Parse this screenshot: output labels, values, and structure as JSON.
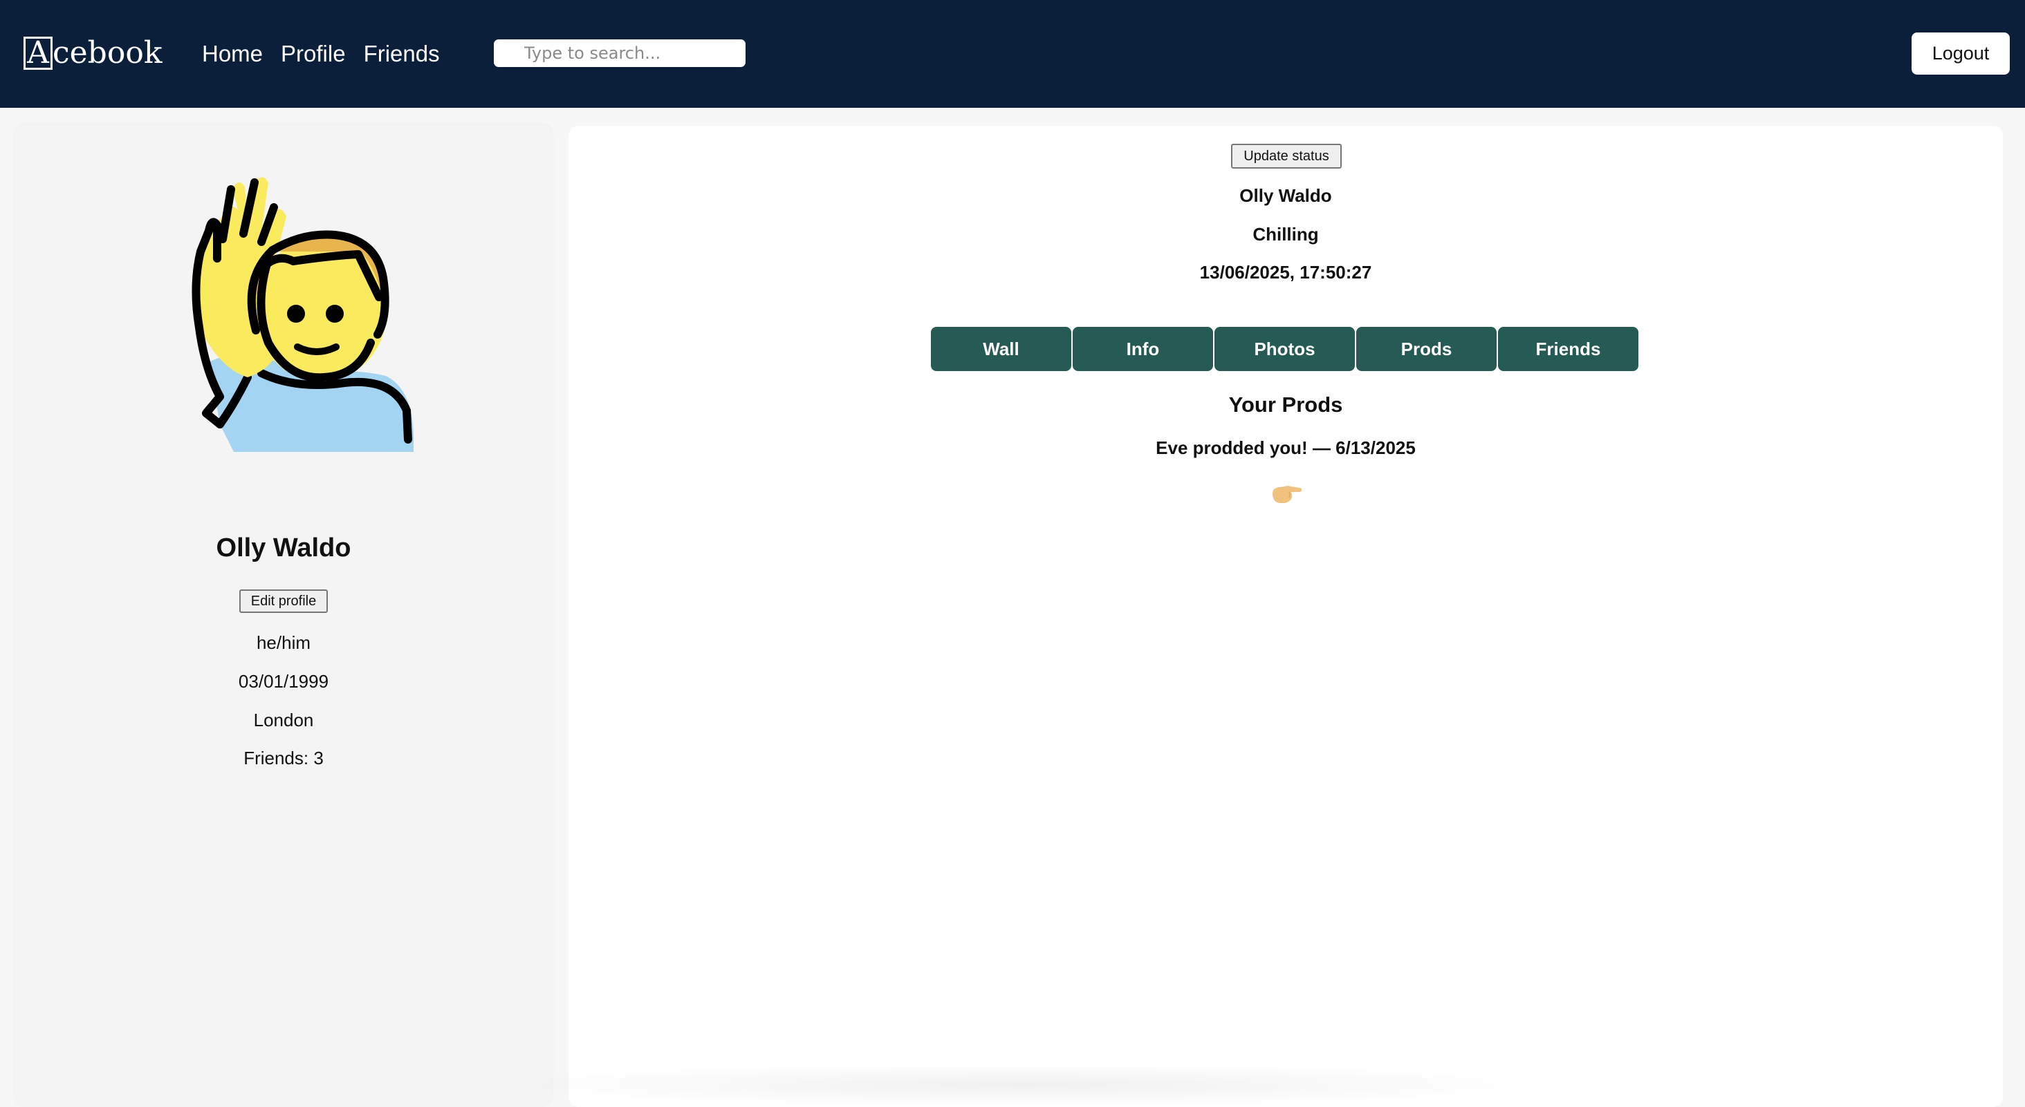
{
  "header": {
    "logo_letter": "A",
    "logo_rest": "cebook",
    "nav": [
      "Home",
      "Profile",
      "Friends"
    ],
    "search_placeholder": "Type to search...",
    "logout_label": "Logout"
  },
  "sidebar": {
    "avatar_icon": "person-raising-hand-icon",
    "name": "Olly Waldo",
    "edit_label": "Edit profile",
    "pronouns": "he/him",
    "birthday": "03/01/1999",
    "location": "London",
    "friends": "Friends: 3"
  },
  "main": {
    "update_status_label": "Update status",
    "name": "Olly Waldo",
    "status": "Chilling",
    "timestamp": "13/06/2025, 17:50:27",
    "tabs": [
      "Wall",
      "Info",
      "Photos",
      "Prods",
      "Friends"
    ],
    "prods_heading": "Your Prods",
    "prod_item": "Eve prodded you! — 6/13/2025",
    "prod_icon": "pointing-hand-icon"
  },
  "colors": {
    "header_bg": "#0c1f3a",
    "tab_bg": "#255b54",
    "page_bg": "#f7f7f7",
    "sidebar_bg": "#f4f4f4"
  }
}
